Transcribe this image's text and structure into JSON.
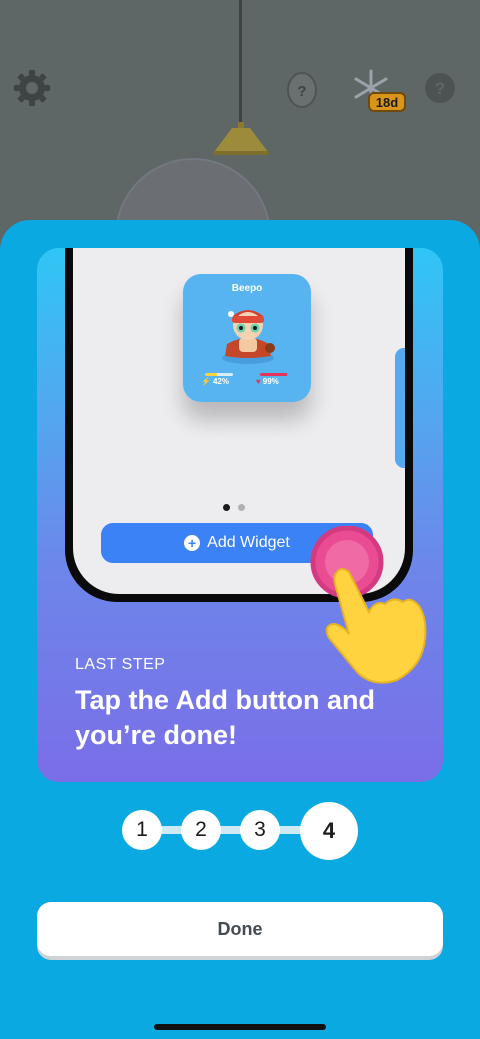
{
  "background": {
    "streak_badge": "18d",
    "icons": [
      "gear-icon",
      "egg-icon",
      "snowflake-icon",
      "help-icon"
    ]
  },
  "onboarding": {
    "widget_preview": {
      "pet_name": "Beepo",
      "energy": "42%",
      "health": "99%",
      "energy_level": 0.42,
      "health_level": 0.99
    },
    "add_widget_label": "Add Widget",
    "page_dots": {
      "count": 2,
      "active_index": 0
    },
    "step_label": "LAST STEP",
    "step_title": "Tap the Add button and you’re done!",
    "steps": [
      "1",
      "2",
      "3",
      "4"
    ],
    "current_step": 4,
    "done_label": "Done"
  },
  "colors": {
    "sheet": "#0aa9e2",
    "accent_blue": "#3b82f6",
    "tap_pink": "#ea4c94",
    "hand_yellow": "#ffd23f"
  }
}
